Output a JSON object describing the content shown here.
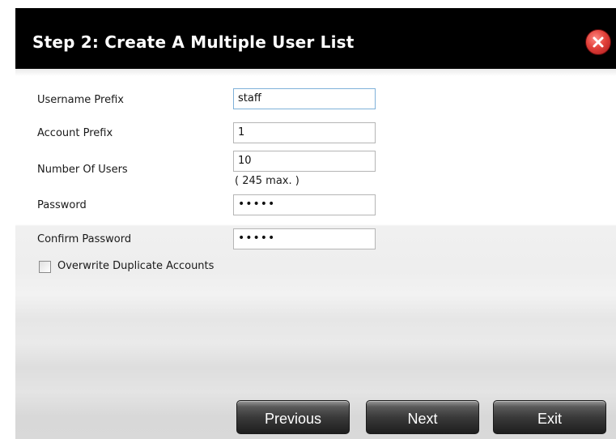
{
  "dialog": {
    "title": "Step 2: Create A Multiple User List",
    "close_icon": "close-icon"
  },
  "form": {
    "username_prefix": {
      "label": "Username Prefix",
      "value": "staff"
    },
    "account_prefix": {
      "label": "Account Prefix",
      "value": "1"
    },
    "number_of_users": {
      "label": "Number Of Users",
      "value": "10",
      "hint": "( 245 max. )"
    },
    "password": {
      "label": "Password",
      "value": "•••••"
    },
    "confirm_password": {
      "label": "Confirm Password",
      "value": "•••••"
    },
    "overwrite": {
      "label": "Overwrite Duplicate Accounts",
      "checked": false
    }
  },
  "buttons": {
    "previous": "Previous",
    "next": "Next",
    "exit": "Exit"
  },
  "colors": {
    "titlebar": "#000000",
    "close_button": "#e2413a",
    "button_dark": "#2a2a2a",
    "input_focus_border": "#7fb1d9"
  }
}
